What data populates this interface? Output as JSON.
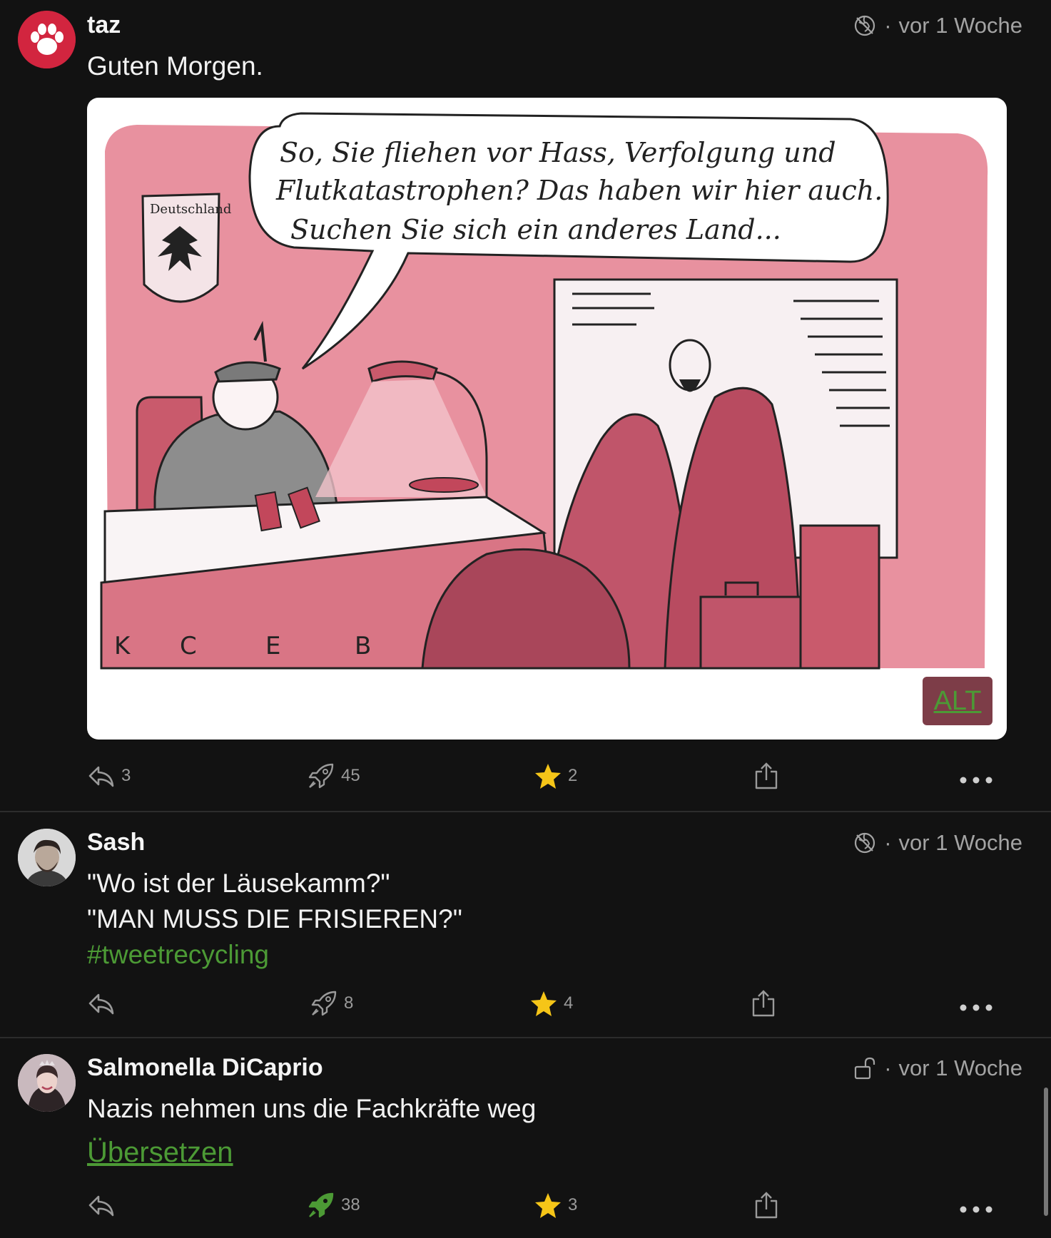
{
  "posts": [
    {
      "author": "taz",
      "time": "vor 1 Woche",
      "visibility_icon": "globe-off-icon",
      "content": "Guten Morgen.",
      "media": {
        "type": "cartoon",
        "speech_line1": "So, Sie fliehen vor Hass, Verfolgung und",
        "speech_line2": "Flutkatastrophen? Das haben wir hier auch.",
        "speech_line3": "Suchen Sie sich ein anderes Land...",
        "shield_text": "Deutschland",
        "alt_label": "ALT"
      },
      "replies": "3",
      "boosts": "45",
      "favourites": "2"
    },
    {
      "author": "Sash",
      "time": "vor 1 Woche",
      "visibility_icon": "globe-off-icon",
      "line1": "\"Wo ist der Läusekamm?\"",
      "line2": "\"MAN MUSS DIE FRISIEREN?\"",
      "hashtag": "#tweetrecycling",
      "boosts": "8",
      "favourites": "4"
    },
    {
      "author": "Salmonella DiCaprio",
      "time": "vor 1 Woche",
      "visibility_icon": "unlock-icon",
      "content": "Nazis nehmen uns die Fachkräfte weg",
      "translate": "Übersetzen",
      "boosts": "38",
      "favourites": "3"
    }
  ],
  "meta_separator": "·",
  "colors": {
    "background": "#121212",
    "accent_green": "#4c9a35",
    "star": "#f5c518",
    "cartoon_pink": "#e8919f",
    "brand_red": "#d2253f"
  }
}
